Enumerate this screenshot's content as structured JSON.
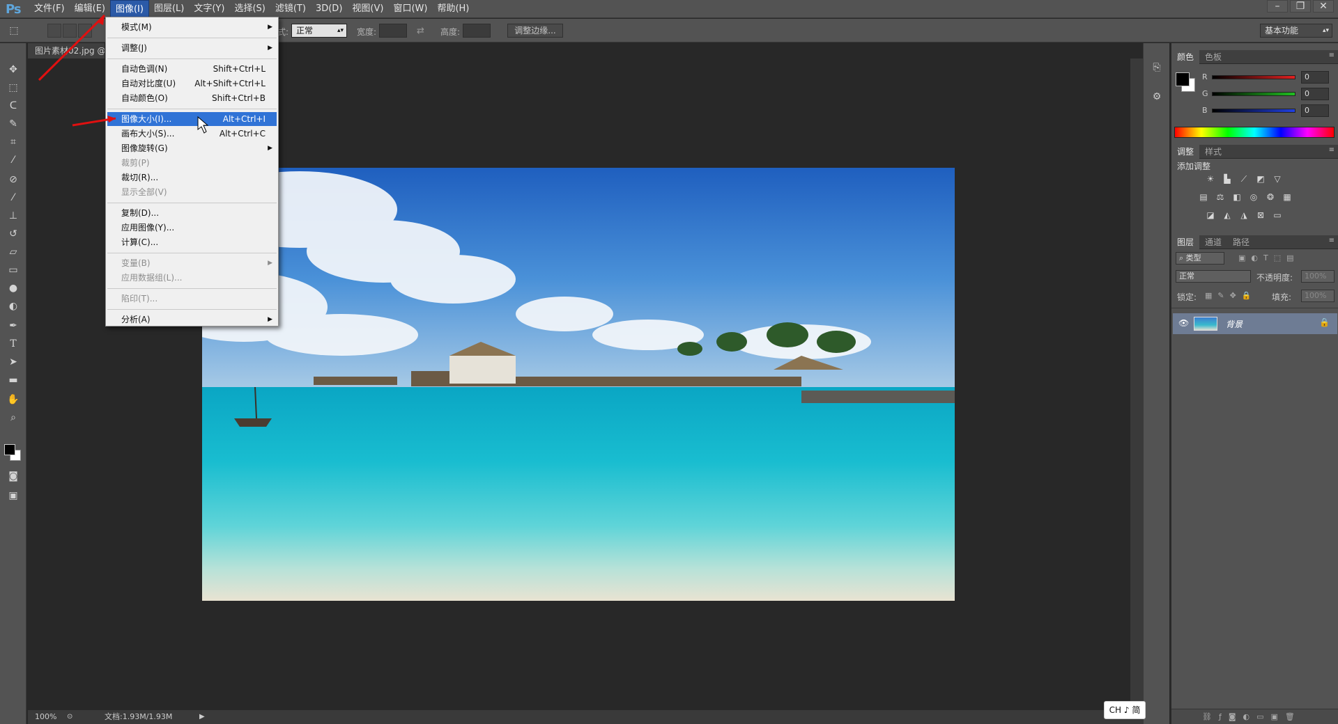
{
  "app": {
    "logo": "Ps"
  },
  "menubar": {
    "items": [
      "文件(F)",
      "编辑(E)",
      "图像(I)",
      "图层(L)",
      "文字(Y)",
      "选择(S)",
      "滤镜(T)",
      "3D(D)",
      "视图(V)",
      "窗口(W)",
      "帮助(H)"
    ],
    "active": "图像(I)"
  },
  "window_controls": {
    "minimize": "–",
    "restore": "❐",
    "close": "✕"
  },
  "options": {
    "style_label": "样式:",
    "style_value": "正常",
    "width_label": "宽度:",
    "height_label": "高度:",
    "refine_edge_button": "调整边缘...",
    "workspace": "基本功能"
  },
  "document": {
    "tab_title": "图片素材02.jpg @",
    "zoom": "100%",
    "doc_info": "文档:1.93M/1.93M"
  },
  "image_menu": {
    "items": [
      {
        "label": "模式(M)",
        "shortcut": "",
        "submenu": true,
        "disabled": false
      },
      {
        "label": "调整(J)",
        "shortcut": "",
        "submenu": true,
        "disabled": false
      },
      {
        "label": "自动色调(N)",
        "shortcut": "Shift+Ctrl+L",
        "submenu": false,
        "disabled": false
      },
      {
        "label": "自动对比度(U)",
        "shortcut": "Alt+Shift+Ctrl+L",
        "submenu": false,
        "disabled": false
      },
      {
        "label": "自动颜色(O)",
        "shortcut": "Shift+Ctrl+B",
        "submenu": false,
        "disabled": false
      },
      {
        "label": "图像大小(I)...",
        "shortcut": "Alt+Ctrl+I",
        "submenu": false,
        "disabled": false,
        "highlighted": true
      },
      {
        "label": "画布大小(S)...",
        "shortcut": "Alt+Ctrl+C",
        "submenu": false,
        "disabled": false
      },
      {
        "label": "图像旋转(G)",
        "shortcut": "",
        "submenu": true,
        "disabled": false
      },
      {
        "label": "裁剪(P)",
        "shortcut": "",
        "submenu": false,
        "disabled": true
      },
      {
        "label": "裁切(R)...",
        "shortcut": "",
        "submenu": false,
        "disabled": false
      },
      {
        "label": "显示全部(V)",
        "shortcut": "",
        "submenu": false,
        "disabled": true
      },
      {
        "label": "复制(D)...",
        "shortcut": "",
        "submenu": false,
        "disabled": false
      },
      {
        "label": "应用图像(Y)...",
        "shortcut": "",
        "submenu": false,
        "disabled": false
      },
      {
        "label": "计算(C)...",
        "shortcut": "",
        "submenu": false,
        "disabled": false
      },
      {
        "label": "变量(B)",
        "shortcut": "",
        "submenu": true,
        "disabled": true
      },
      {
        "label": "应用数据组(L)...",
        "shortcut": "",
        "submenu": false,
        "disabled": true
      },
      {
        "label": "陷印(T)...",
        "shortcut": "",
        "submenu": false,
        "disabled": true
      },
      {
        "label": "分析(A)",
        "shortcut": "",
        "submenu": true,
        "disabled": false
      }
    ]
  },
  "color_panel": {
    "tabs": [
      "颜色",
      "色板"
    ],
    "channels": [
      {
        "name": "R",
        "value": "0",
        "color": "#e02020"
      },
      {
        "name": "G",
        "value": "0",
        "color": "#20c020"
      },
      {
        "name": "B",
        "value": "0",
        "color": "#2040e0"
      }
    ]
  },
  "adjustments_panel": {
    "tabs": [
      "调整",
      "样式"
    ],
    "title": "添加调整",
    "row1": [
      "brightness-icon",
      "levels-icon",
      "curves-icon",
      "exposure-icon",
      "vibrance-icon"
    ],
    "row2": [
      "hue-saturation-icon",
      "color-balance-icon",
      "black-white-icon",
      "photo-filter-icon",
      "channel-mixer-icon",
      "color-lookup-icon"
    ],
    "row3": [
      "invert-icon",
      "posterize-icon",
      "threshold-icon",
      "selective-color-icon",
      "gradient-map-icon"
    ]
  },
  "layers_panel": {
    "tabs": [
      "图层",
      "通道",
      "路径"
    ],
    "filter_label": "类型",
    "blend_mode": "正常",
    "opacity_label": "不透明度:",
    "opacity_value": "100%",
    "lock_label": "锁定:",
    "fill_label": "填充:",
    "fill_value": "100%",
    "layers": [
      {
        "name": "背景",
        "locked": true,
        "visible": true
      }
    ]
  },
  "ime": {
    "label": "CH ♪ 简"
  }
}
